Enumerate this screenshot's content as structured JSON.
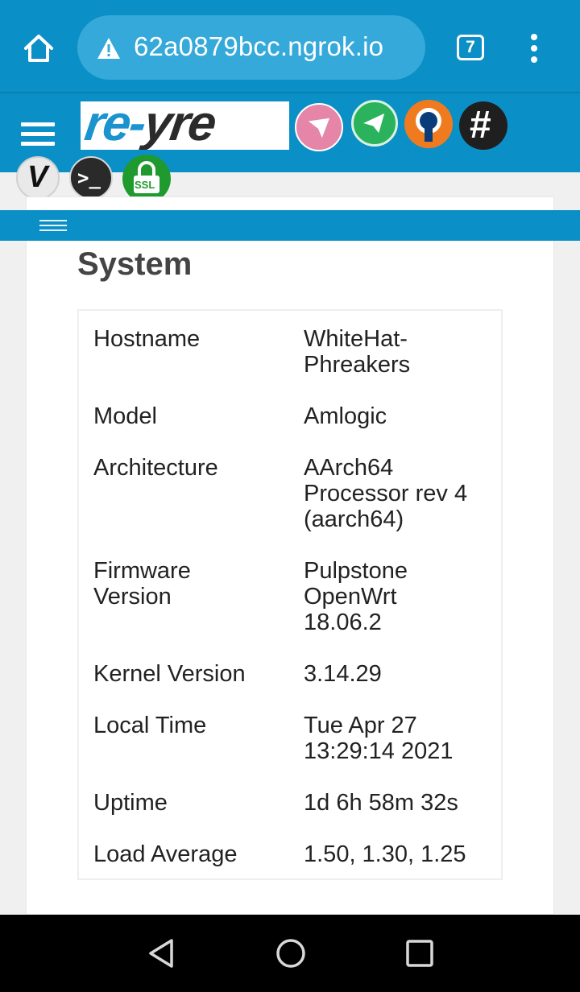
{
  "browser": {
    "url": "62a0879bcc.ngrok.io",
    "tab_count": "7"
  },
  "header": {
    "logo_text_left": "re-",
    "logo_text_right": "yre",
    "quick_icons": [
      "send-pink-icon",
      "send-green-icon",
      "openvpn-icon",
      "hashtag-icon",
      "v2ray-icon",
      "terminal-icon",
      "ssl-lock-icon"
    ],
    "ssl_label": "SSL",
    "hash_label": "#",
    "terminal_label": ">_",
    "v_label": "V"
  },
  "main": {
    "title": "System",
    "rows": [
      {
        "key": "Hostname",
        "value": "WhiteHat-Phreakers"
      },
      {
        "key": "Model",
        "value": "Amlogic"
      },
      {
        "key": "Architecture",
        "value": "AArch64 Processor rev 4 (aarch64)"
      },
      {
        "key": "Firmware Version",
        "value": "Pulpstone OpenWrt 18.06.2"
      },
      {
        "key": "Kernel Version",
        "value": "3.14.29"
      },
      {
        "key": "Local Time",
        "value": "Tue Apr 27 13:29:14 2021"
      },
      {
        "key": "Uptime",
        "value": "1d 6h 58m 32s"
      },
      {
        "key": "Load Average",
        "value": "1.50, 1.30, 1.25"
      }
    ]
  },
  "colors": {
    "brand": "#0b8fc7",
    "url_pill": "#34a9da",
    "ssl_green": "#1f9a2e"
  }
}
